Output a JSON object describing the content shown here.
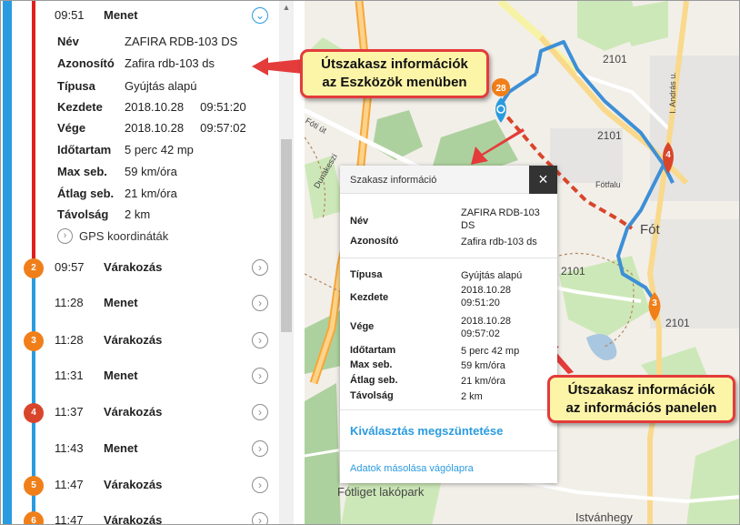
{
  "timeline": {
    "expanded": {
      "time": "09:51",
      "title": "Menet",
      "details": [
        {
          "label": "Név",
          "value": "ZAFIRA RDB-103 DS"
        },
        {
          "label": "Azonosító",
          "value": "Zafira rdb-103 ds"
        },
        {
          "label": "Típusa",
          "value": "Gyújtás alapú"
        },
        {
          "label": "Kezdete",
          "value": "2018.10.28     09:51:20"
        },
        {
          "label": "Vége",
          "value": "2018.10.28     09:57:02"
        },
        {
          "label": "Időtartam",
          "value": "5 perc 42 mp"
        },
        {
          "label": "Max seb.",
          "value": "59 km/óra"
        },
        {
          "label": "Átlag seb.",
          "value": "21 km/óra"
        },
        {
          "label": "Távolság",
          "value": "2 km"
        }
      ],
      "gps_label": "GPS koordináták"
    },
    "rows": [
      {
        "badge": "2",
        "time": "09:57",
        "title": "Várakozás"
      },
      {
        "badge": "",
        "time": "11:28",
        "title": "Menet"
      },
      {
        "badge": "3",
        "time": "11:28",
        "title": "Várakozás"
      },
      {
        "badge": "",
        "time": "11:31",
        "title": "Menet"
      },
      {
        "badge": "4",
        "time": "11:37",
        "title": "Várakozás"
      },
      {
        "badge": "",
        "time": "11:43",
        "title": "Menet"
      },
      {
        "badge": "5",
        "time": "11:47",
        "title": "Várakozás"
      },
      {
        "badge": "6",
        "time": "11:47",
        "title": "Várakozás"
      }
    ]
  },
  "popup": {
    "title": "Szakasz információ",
    "close": "×",
    "fields": [
      {
        "label": "Név",
        "value": "ZAFIRA RDB-103 DS"
      },
      {
        "label": "Azonosító",
        "value": "Zafira rdb-103 ds"
      },
      {
        "label": "Típusa",
        "value": "Gyújtás alapú"
      },
      {
        "label": "Kezdete",
        "value": "2018.10.28 09:51:20"
      },
      {
        "label": "Vége",
        "value": "2018.10.28 09:57:02"
      },
      {
        "label": "Időtartam",
        "value": "5 perc 42 mp"
      },
      {
        "label": "Max seb.",
        "value": "59 km/óra"
      },
      {
        "label": "Átlag seb.",
        "value": "21 km/óra"
      },
      {
        "label": "Távolság",
        "value": "2 km"
      }
    ],
    "deselect": "Kiválasztás megszüntetése",
    "copy": "Adatok másolása vágólapra"
  },
  "callouts": {
    "menu": {
      "line1": "Útszakasz információk",
      "line2": "az Eszközök menüben"
    },
    "panel": {
      "line1": "Útszakasz információk",
      "line2": "az információs panelen"
    }
  },
  "map": {
    "labels": {
      "road_2101_a": "2101",
      "road_2101_b": "2101",
      "road_2101_c": "2101",
      "road_2101_d": "2101",
      "fot": "Fót",
      "fotliget": "Fótliget lakópark",
      "istvanhegy": "Istvánhegy",
      "fotfalu": "Fótfalu",
      "fot_ut": "Fóti út",
      "dunakeszi": "Dunakeszi",
      "andras": "I. András u."
    },
    "markers": {
      "m28": "28",
      "m4": "4",
      "m3": "3"
    }
  },
  "colors": {
    "route": "#3d8fd6",
    "route_selected": "#e0201c",
    "accent": "#2a9be0",
    "callout_border": "#e43b3b",
    "callout_bg": "#fcf5a8"
  }
}
